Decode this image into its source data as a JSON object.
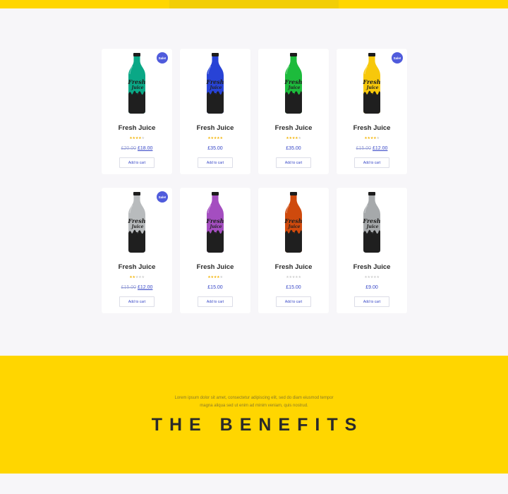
{
  "colors": {
    "accent_yellow": "#ffd600",
    "sale_badge": "#4f5bdc",
    "price_link": "#3747c7",
    "star": "#f3b50b"
  },
  "products": [
    {
      "title": "Fresh Juice",
      "rating": 4,
      "old_price": "£20.00",
      "price": "£18.00",
      "sale": true,
      "sale_label": "Sale!",
      "bottle_color": "#0aa886",
      "cart_label": "Add to cart"
    },
    {
      "title": "Fresh Juice",
      "rating": 5,
      "old_price": "",
      "price": "£35.00",
      "sale": false,
      "sale_label": "",
      "bottle_color": "#2843d6",
      "cart_label": "Add to cart"
    },
    {
      "title": "Fresh Juice",
      "rating": 4,
      "old_price": "",
      "price": "£35.00",
      "sale": false,
      "sale_label": "",
      "bottle_color": "#1dbb3c",
      "cart_label": "Add to cart"
    },
    {
      "title": "Fresh Juice",
      "rating": 4,
      "old_price": "£15.00",
      "price": "£12.00",
      "sale": true,
      "sale_label": "Sale!",
      "bottle_color": "#f7c80b",
      "cart_label": "Add to cart"
    },
    {
      "title": "Fresh Juice",
      "rating": 2,
      "old_price": "£15.00",
      "price": "£12.00",
      "sale": true,
      "sale_label": "Sale!",
      "bottle_color": "#b8bbbd",
      "cart_label": "Add to cart"
    },
    {
      "title": "Fresh Juice",
      "rating": 4,
      "old_price": "",
      "price": "£15.00",
      "sale": false,
      "sale_label": "",
      "bottle_color": "#a44ec0",
      "cart_label": "Add to cart"
    },
    {
      "title": "Fresh Juice",
      "rating": 0,
      "old_price": "",
      "price": "£15.00",
      "sale": false,
      "sale_label": "",
      "bottle_color": "#cf4a0d",
      "cart_label": "Add to cart"
    },
    {
      "title": "Fresh Juice",
      "rating": 0,
      "old_price": "",
      "price": "£9.00",
      "sale": false,
      "sale_label": "",
      "bottle_color": "#a6a9ab",
      "cart_label": "Add to cart"
    }
  ],
  "benefits": {
    "text_line1": "Lorem ipsum dolor sit amet, consectetur adipiscing elit, sed do diam eiusmod tempor",
    "text_line2": "magna aliqua sed ut enim ad minim veniam, quis nostrud.",
    "title": "THE BENEFITS"
  },
  "bottle_label": {
    "line1": "Fresh",
    "line2": "Juice"
  }
}
